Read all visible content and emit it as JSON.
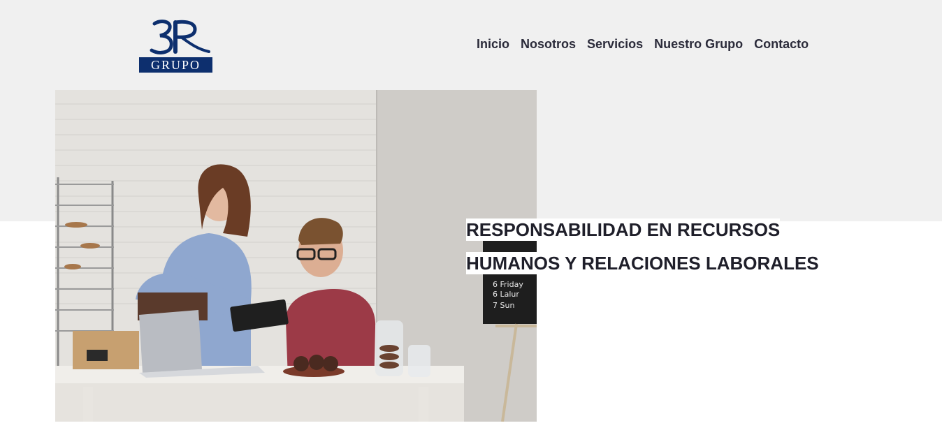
{
  "logo": {
    "mark_text": "3R",
    "bar_text": "GRUPO",
    "brand_color": "#0d2f6e"
  },
  "nav": {
    "items": [
      {
        "label": "Inicio"
      },
      {
        "label": "Nosotros"
      },
      {
        "label": "Servicios"
      },
      {
        "label": "Nuestro Grupo"
      },
      {
        "label": "Contacto"
      }
    ]
  },
  "hero": {
    "image_icon": "office-team-photo",
    "headline_line1": "RESPONSABILIDAD EN RECURSOS",
    "headline_line2": "HUMANOS Y RELACIONES LABORALES"
  },
  "colors": {
    "top_band": "#f0f0f0",
    "text_dark": "#2b2b3a",
    "background": "#ffffff"
  }
}
